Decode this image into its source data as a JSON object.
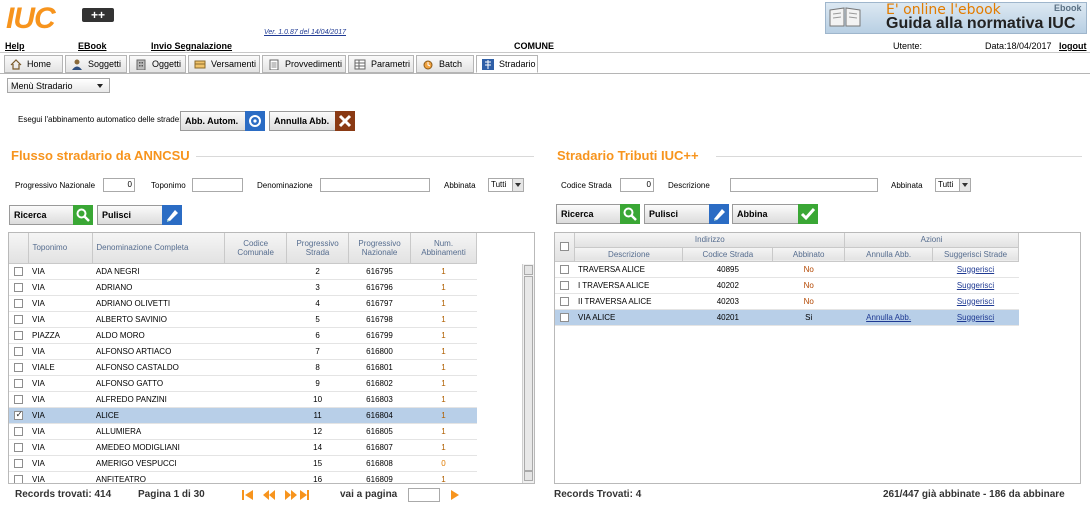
{
  "header": {
    "logo": "IUC",
    "logo_plus": "++",
    "version": "Ver. 1.0.87 del 14/04/2017",
    "banner_online": "E' online l'ebook",
    "banner_ebook": "Ebook",
    "banner_guide": "Guida alla normativa IUC"
  },
  "menubar": {
    "help": "Help",
    "ebook": "EBook",
    "invio": "Invio Segnalazione",
    "comune": "COMUNE",
    "utente": "Utente:",
    "data": "Data:18/04/2017",
    "logout": "logout"
  },
  "tabs": [
    {
      "label": "Home"
    },
    {
      "label": "Soggetti"
    },
    {
      "label": "Oggetti"
    },
    {
      "label": "Versamenti"
    },
    {
      "label": "Provvedimenti"
    },
    {
      "label": "Parametri"
    },
    {
      "label": "Batch"
    },
    {
      "label": "Stradario"
    }
  ],
  "menu_select": "Menù Stradario",
  "auto": {
    "label": "Esegui l'abbinamento automatico delle strade:",
    "btn_auto": "Abb. Autom.",
    "btn_annulla": "Annulla Abb."
  },
  "left": {
    "title": "Flusso stradario da ANNCSU",
    "filters": {
      "progressivo_label": "Progressivo Nazionale",
      "progressivo_value": "0",
      "toponimo_label": "Toponimo",
      "denominazione_label": "Denominazione",
      "abbinata_label": "Abbinata",
      "abbinata_value": "Tutti"
    },
    "btn_ricerca": "Ricerca",
    "btn_pulisci": "Pulisci",
    "columns": [
      "Toponimo",
      "Denominazione Completa",
      "Codice Comunale",
      "Progressivo Strada",
      "Progressivo Nazionale",
      "Num. Abbinamenti"
    ],
    "rows": [
      {
        "top": "VIA",
        "den": "ADA NEGRI",
        "prog": "2",
        "naz": "616795",
        "num": "1"
      },
      {
        "top": "VIA",
        "den": "ADRIANO",
        "prog": "3",
        "naz": "616796",
        "num": "1"
      },
      {
        "top": "VIA",
        "den": "ADRIANO OLIVETTI",
        "prog": "4",
        "naz": "616797",
        "num": "1"
      },
      {
        "top": "VIA",
        "den": "ALBERTO SAVINIO",
        "prog": "5",
        "naz": "616798",
        "num": "1"
      },
      {
        "top": "PIAZZA",
        "den": "ALDO MORO",
        "prog": "6",
        "naz": "616799",
        "num": "1"
      },
      {
        "top": "VIA",
        "den": "ALFONSO ARTIACO",
        "prog": "7",
        "naz": "616800",
        "num": "1"
      },
      {
        "top": "VIALE",
        "den": "ALFONSO CASTALDO",
        "prog": "8",
        "naz": "616801",
        "num": "1"
      },
      {
        "top": "VIA",
        "den": "ALFONSO GATTO",
        "prog": "9",
        "naz": "616802",
        "num": "1"
      },
      {
        "top": "VIA",
        "den": "ALFREDO PANZINI",
        "prog": "10",
        "naz": "616803",
        "num": "1"
      },
      {
        "top": "VIA",
        "den": "ALICE",
        "prog": "11",
        "naz": "616804",
        "num": "1"
      },
      {
        "top": "VIA",
        "den": "ALLUMIERA",
        "prog": "12",
        "naz": "616805",
        "num": "1"
      },
      {
        "top": "VIA",
        "den": "AMEDEO MODIGLIANI",
        "prog": "14",
        "naz": "616807",
        "num": "1"
      },
      {
        "top": "VIA",
        "den": "AMERIGO VESPUCCI",
        "prog": "15",
        "naz": "616808",
        "num": "0"
      },
      {
        "top": "VIA",
        "den": "ANFITEATRO",
        "prog": "16",
        "naz": "616809",
        "num": "1"
      }
    ],
    "selected_row": 9,
    "records": "Records trovati: 414",
    "pagina": "Pagina 1 di 30",
    "vai": "vai a pagina"
  },
  "right": {
    "title": "Stradario Tributi IUC++",
    "filters": {
      "codice_label": "Codice Strada",
      "codice_value": "0",
      "descrizione_label": "Descrizione",
      "abbinata_label": "Abbinata",
      "abbinata_value": "Tutti"
    },
    "btn_ricerca": "Ricerca",
    "btn_pulisci": "Pulisci",
    "btn_abbina": "Abbina",
    "group_indirizzo": "Indirizzo",
    "group_azioni": "Azioni",
    "columns": [
      "Descrizione",
      "Codice Strada",
      "Abbinato",
      "Annulla Abb.",
      "Suggerisci Strade"
    ],
    "rows": [
      {
        "desc": "TRAVERSA ALICE",
        "cod": "40895",
        "abb": "No",
        "ann": "",
        "sug": "Suggerisci"
      },
      {
        "desc": "I TRAVERSA ALICE",
        "cod": "40202",
        "abb": "No",
        "ann": "",
        "sug": "Suggerisci"
      },
      {
        "desc": "II TRAVERSA ALICE",
        "cod": "40203",
        "abb": "No",
        "ann": "",
        "sug": "Suggerisci"
      },
      {
        "desc": "VIA ALICE",
        "cod": "40201",
        "abb": "Si",
        "ann": "Annulla Abb.",
        "sug": "Suggerisci"
      }
    ],
    "records": "Records Trovati: 4",
    "summary": "261/447 già abbinate - 186 da abbinare"
  },
  "colors": {
    "accent": "#f7941d",
    "selected": "#b8cfe8",
    "link": "#1f3a93"
  }
}
